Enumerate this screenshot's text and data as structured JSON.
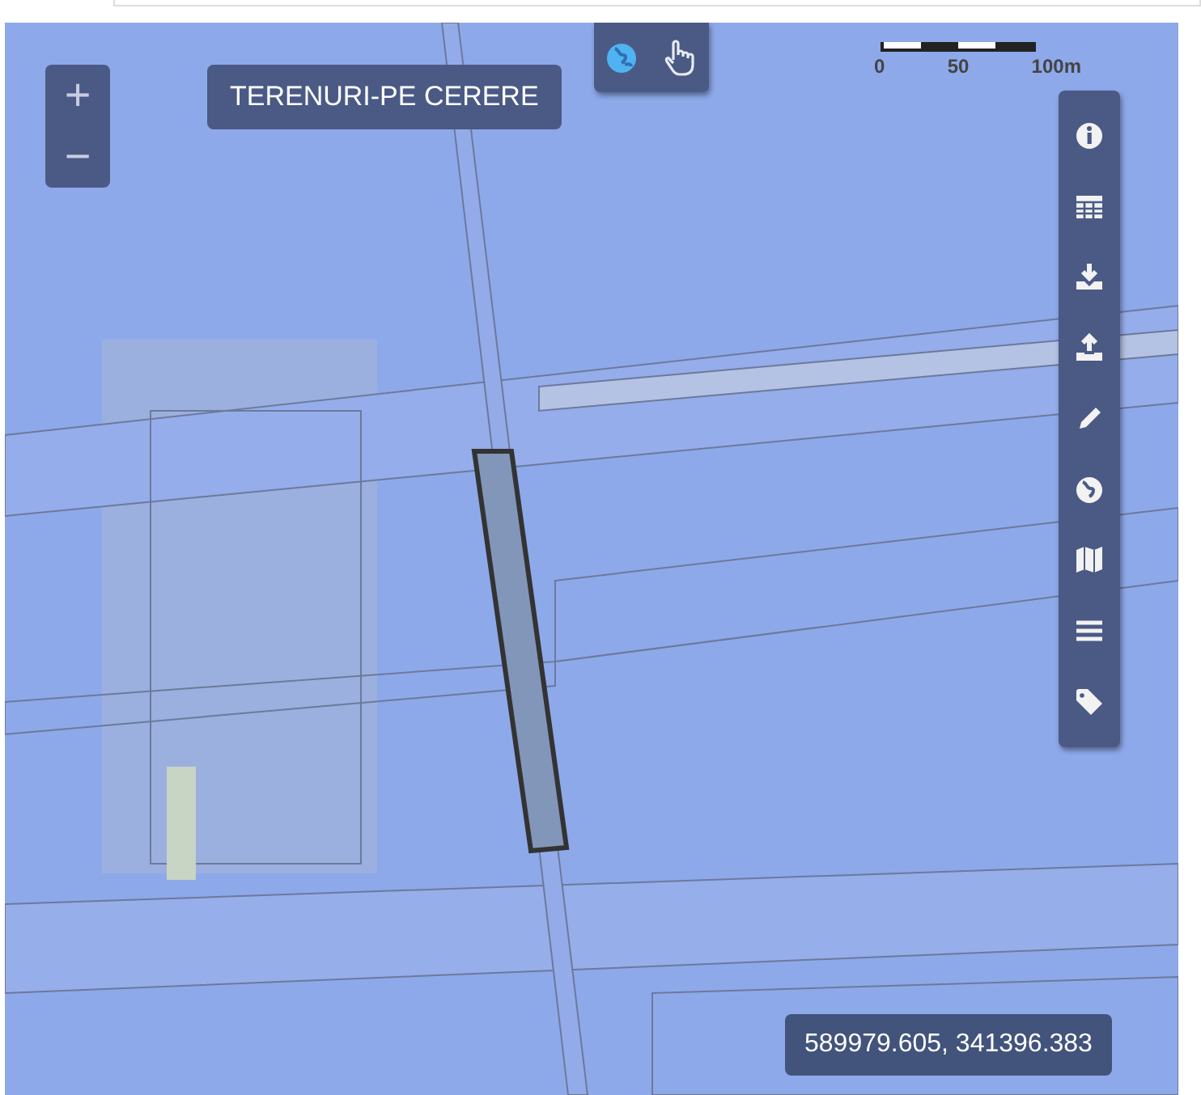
{
  "zoom": {
    "in": "+",
    "out": "−"
  },
  "layer_title": "TERENURI-PE CERERE",
  "map_tools": [
    {
      "selected": true
    },
    {
      "selected": false
    }
  ],
  "scale": {
    "labels": [
      "0",
      "50",
      "100m"
    ]
  },
  "coordinates": "589979.605, 341396.383"
}
